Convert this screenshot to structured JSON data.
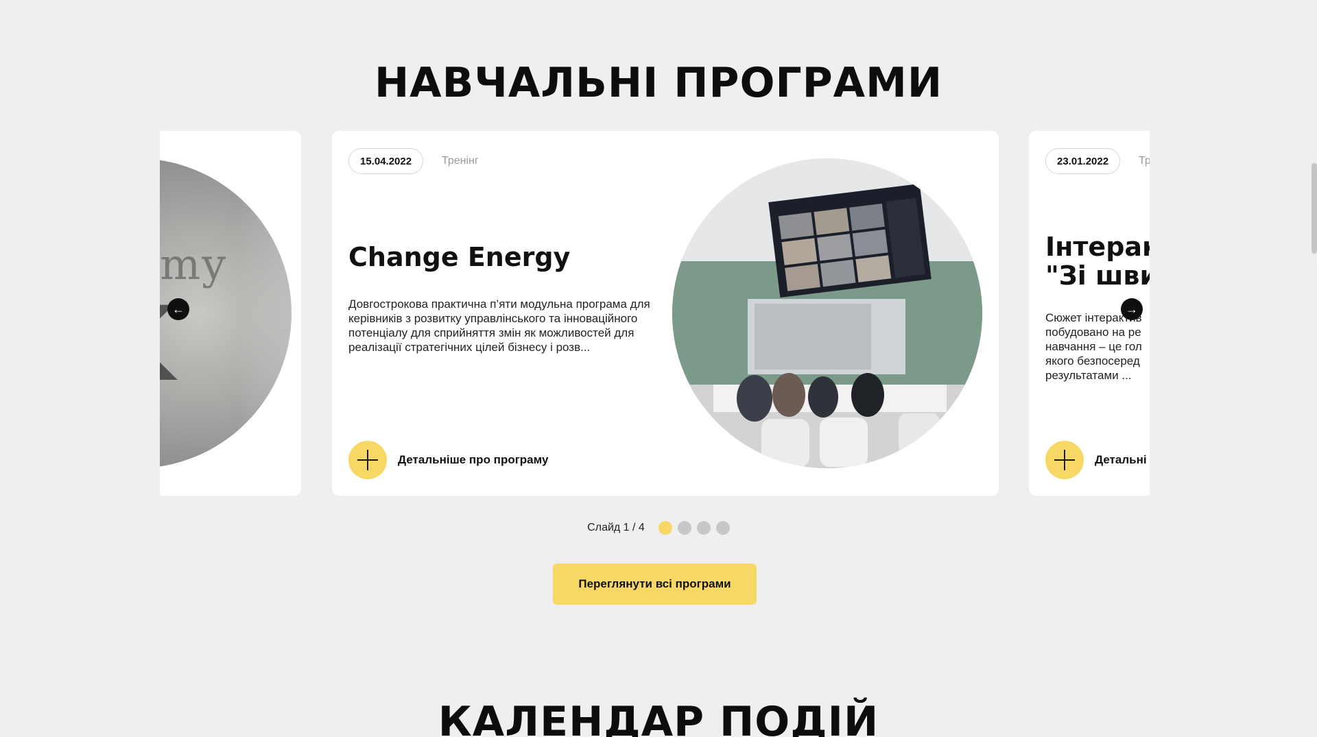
{
  "section_title": "НАВЧАЛЬНІ ПРОГРАМИ",
  "next_section_title": "КАЛЕНДАР ПОДІЙ",
  "cards": [
    {
      "date": "15.04.2022",
      "type": "Тренінг",
      "title": "Change Energy",
      "description": "Довгострокова практична п’яти модульна програма для керівників з розвитку управлінського та інноваційного потенціалу для сприйняття змін як можливостей для реалізації стратегічних цілей бізнесу і розв...",
      "more_label": "Детальніше про програму"
    },
    {
      "date": "23.01.2022",
      "type": "Тр",
      "title": "Інтеракт\n\"Зі швид",
      "description": "Сюжет інтерактив\nпобудовано на ре\nнавчання – це гол\nякого безпосеред\nрезультатами ...",
      "more_label": "Детальні"
    }
  ],
  "left_card_image_text": "demy",
  "pager": {
    "label": "Слайд 1 / 4",
    "total": 4,
    "active": 1
  },
  "cta_label": "Переглянути всі програми",
  "arrows": {
    "prev": "←",
    "next": "→"
  },
  "colors": {
    "accent": "#f8d865",
    "background": "#efefef",
    "dot_inactive": "#c7c7c7"
  }
}
